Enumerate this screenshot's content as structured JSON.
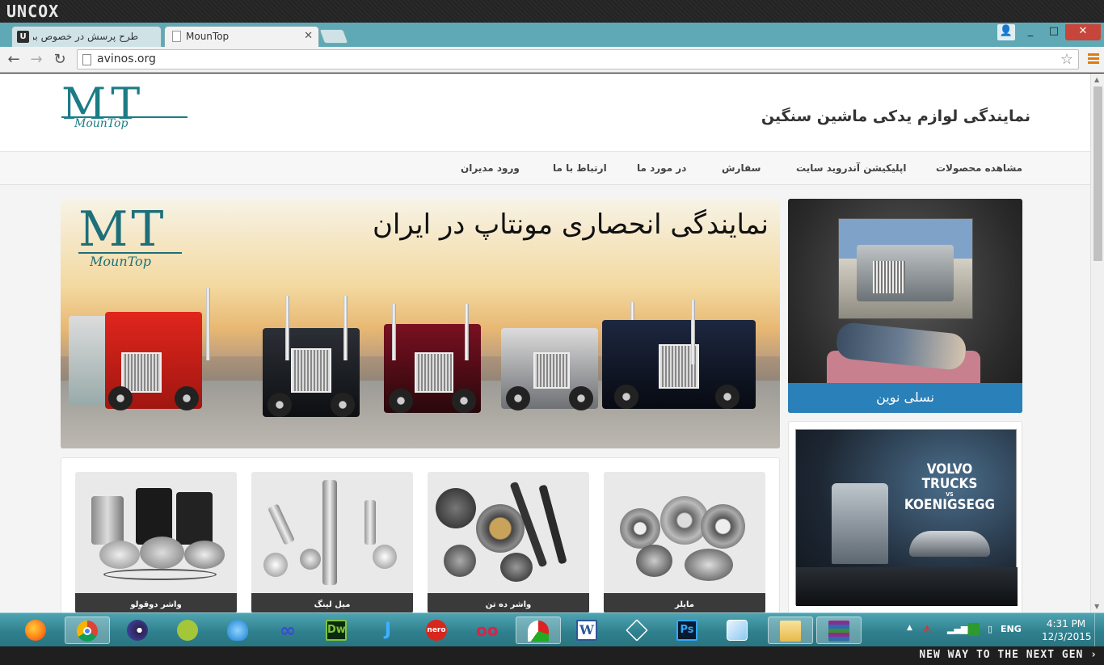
{
  "os": {
    "brand": "UNCOX",
    "slogan": "NEW WAY TO THE NEXT GEN ›"
  },
  "browser": {
    "tabs": [
      {
        "title": "طرح پرسش در خصوص برنا",
        "active": false
      },
      {
        "title": "MounTop",
        "active": true
      }
    ],
    "url": "avinos.org",
    "window_buttons": [
      "_",
      "□",
      "✕"
    ]
  },
  "site": {
    "logo": {
      "mark": "MT",
      "sub": "MounTop"
    },
    "title": "نمایندگی لوازم یدکی ماشین سنگین",
    "nav": [
      "مشاهده محصولات",
      "اپلیکیشن آندروید سایت",
      "سفارش",
      "در مورد ما",
      "ارتباط با ما",
      "ورود مدیران"
    ],
    "banner": {
      "logo_mark": "MT",
      "logo_sub": "MounTop",
      "headline": "نمایندگی انحصاری مونتاپ در ایران"
    },
    "sidebar": {
      "card1_caption": "نسلی نوین",
      "card2_title": "VOLVO TRUCKS",
      "card2_vs": "VS",
      "card2_subtitle": "KOENIGSEGG"
    },
    "products": [
      {
        "label": "واشر دوقولو"
      },
      {
        "label": "میل لینگ"
      },
      {
        "label": "واشر ده تن"
      },
      {
        "label": "مایلر"
      }
    ]
  },
  "taskbar": {
    "apps": [
      "firefox-icon",
      "chrome-icon",
      "eclipse-icon",
      "android-studio-icon",
      "dropbox-like-icon",
      "infinity-icon",
      "dreamweaver-icon",
      "jetbrains-icon",
      "nero-icon",
      "glasses-icon",
      "chart-icon",
      "word-icon",
      "unity-icon",
      "photoshop-icon",
      "cube-icon",
      "file-explorer-icon",
      "winrar-icon"
    ],
    "dw_label": "Dw",
    "ps_label": "Ps",
    "word_label": "W",
    "nero_label": "nero",
    "lang": "ENG",
    "time": "4:31 PM",
    "date": "12/3/2015"
  }
}
